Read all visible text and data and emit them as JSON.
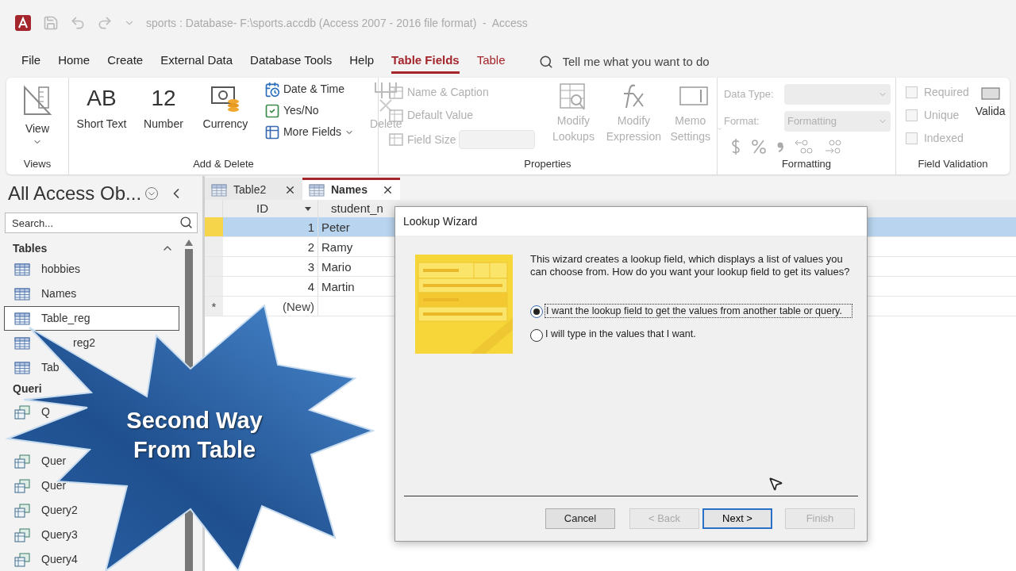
{
  "title_bar": {
    "title": "sports : Database- F:\\sports.accdb (Access 2007 - 2016 file format)  -  Access"
  },
  "menu_tabs": [
    {
      "label": "File",
      "selected": false
    },
    {
      "label": "Home",
      "selected": false
    },
    {
      "label": "Create",
      "selected": false
    },
    {
      "label": "External Data",
      "selected": false
    },
    {
      "label": "Database Tools",
      "selected": false
    },
    {
      "label": "Help",
      "selected": false
    },
    {
      "label": "Table Fields",
      "selected": true
    },
    {
      "label": "Table",
      "selected": false
    }
  ],
  "tell_me": {
    "placeholder": "Tell me what you want to do"
  },
  "ribbon": {
    "views": {
      "label": "Views",
      "view": {
        "label": "View",
        "disabled": false
      }
    },
    "add_delete": {
      "label": "Add & Delete",
      "large": [
        {
          "glyph": "AB",
          "label": "Short Text",
          "disabled": false
        },
        {
          "glyph": "12",
          "label": "Number",
          "disabled": false
        },
        {
          "label": "Currency",
          "disabled": false
        }
      ],
      "small": [
        {
          "label": "Date & Time",
          "disabled": false
        },
        {
          "label": "Yes/No",
          "disabled": false
        },
        {
          "label": "More Fields",
          "disabled": false
        }
      ],
      "delete": {
        "label": "Delete",
        "disabled": true
      }
    },
    "properties": {
      "label": "Properties",
      "small": [
        {
          "label": "Name & Caption",
          "disabled": true
        },
        {
          "label": "Default Value",
          "disabled": true
        },
        {
          "label": "Field Size",
          "disabled": true
        }
      ],
      "large": [
        {
          "label": "Modify Lookups",
          "disabled": true
        },
        {
          "label": "Modify Expression",
          "disabled": true
        },
        {
          "label": "Memo Settings",
          "disabled": true
        }
      ]
    },
    "formatting": {
      "label": "Formatting",
      "data_type": {
        "label": "Data Type:",
        "disabled": true
      },
      "format": {
        "label": "Format:",
        "value": "Formatting",
        "disabled": true
      }
    },
    "field_validation": {
      "label": "Field Validation",
      "checks": [
        {
          "label": "Required",
          "checked": false,
          "disabled": true
        },
        {
          "label": "Unique",
          "checked": false,
          "disabled": true
        },
        {
          "label": "Indexed",
          "checked": false,
          "disabled": true
        }
      ],
      "validation": {
        "label": "Valida"
      }
    }
  },
  "nav_pane": {
    "title": "All Access Ob...",
    "search": {
      "placeholder": "Search..."
    },
    "sections": [
      {
        "label": "Tables",
        "items": [
          {
            "kind": "table",
            "label": "hobbies",
            "selected": false
          },
          {
            "kind": "table",
            "label": "Names",
            "selected": false
          },
          {
            "kind": "table",
            "label": "Table_reg",
            "selected": true
          },
          {
            "kind": "table",
            "label": "reg2",
            "selected": false
          },
          {
            "kind": "table",
            "label": "Tab",
            "selected": false
          }
        ]
      },
      {
        "label": "Queri",
        "items": [
          {
            "kind": "query",
            "label": "Q",
            "selected": false
          },
          {
            "kind": "query",
            "label": "Quer",
            "selected": false
          },
          {
            "kind": "query",
            "label": "Quer",
            "selected": false
          },
          {
            "kind": "query",
            "label": "Query2",
            "selected": false
          },
          {
            "kind": "query",
            "label": "Query3",
            "selected": false
          },
          {
            "kind": "query",
            "label": "Query4",
            "selected": false
          }
        ]
      }
    ]
  },
  "doc_tabs": [
    {
      "label": "Table2",
      "selected": false
    },
    {
      "label": "Names",
      "selected": true
    }
  ],
  "datasheet": {
    "columns": [
      "ID",
      "student_n"
    ],
    "rows": [
      {
        "id": "1",
        "name": "Peter",
        "selected": true
      },
      {
        "id": "2",
        "name": "Ramy",
        "selected": false
      },
      {
        "id": "3",
        "name": "Mario",
        "selected": false
      },
      {
        "id": "4",
        "name": "Martin",
        "selected": false
      }
    ],
    "new_row": {
      "marker": "*",
      "id": "(New)"
    }
  },
  "wizard": {
    "title": "Lookup Wizard",
    "description": "This wizard creates a lookup field, which displays a list of values you can choose from.  How do you want your lookup field to get its values?",
    "options": [
      {
        "label": "I want the lookup field to get the values from another table or query.",
        "selected": true
      },
      {
        "label": "I will type in the values that I want.",
        "selected": false
      }
    ],
    "buttons": [
      {
        "label": "Cancel",
        "disabled": false,
        "default": false
      },
      {
        "label": "< Back",
        "disabled": true,
        "default": false
      },
      {
        "label": "Next >",
        "disabled": false,
        "default": true
      },
      {
        "label": "Finish",
        "disabled": true,
        "default": false
      }
    ]
  },
  "callout": {
    "lines": [
      "Second Way",
      "From Table"
    ]
  }
}
